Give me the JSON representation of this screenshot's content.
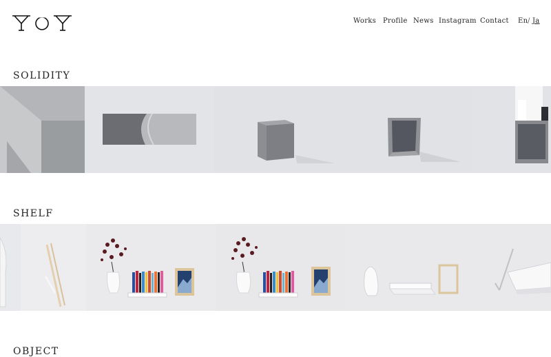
{
  "header": {
    "logo_text": "YOY"
  },
  "nav": {
    "items": [
      {
        "label": "Works"
      },
      {
        "label": "Profile"
      },
      {
        "label": "News"
      },
      {
        "label": "Instagram"
      },
      {
        "label": "Contact"
      }
    ],
    "lang": {
      "en": "En",
      "separator": "/",
      "ja": "Ja"
    }
  },
  "sections": [
    {
      "title": "SOLIDITY",
      "images": [
        "concrete-table-corner",
        "concrete-slab",
        "concrete-cube",
        "concrete-open-box",
        "person-sitting-on-box"
      ]
    },
    {
      "title": "SHELF",
      "images": [
        "vase-and-shelf-partial",
        "flowers-books-shelf",
        "flowers-books-shelf-alt",
        "vase-frame-empty-shelf",
        "lamp-shelf-partial"
      ]
    },
    {
      "title": "OBJECT"
    }
  ]
}
